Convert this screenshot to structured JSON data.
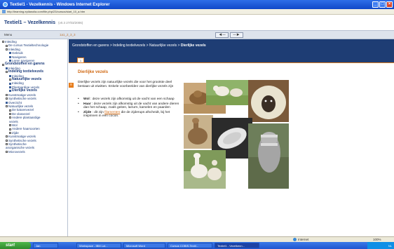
{
  "window": {
    "title": "Textiel1 - Vezelkennis - Windows Internet Explorer",
    "address": "http://learning.epilanolia.com/file.php/23/cursus/start_10_a.htm",
    "controls": [
      "_",
      "□",
      "×"
    ]
  },
  "app": {
    "title": "Textiel1 – Vezelkennis",
    "version": "(v0.3 27/03/2006)"
  },
  "menubar": {
    "label": "Menu",
    "code": "1a1_2_3_3",
    "prev_arrow": "◄─",
    "next_arrow": "─►"
  },
  "tree": [
    {
      "label": "Inleiding",
      "level": 1,
      "type": "folder"
    },
    {
      "label": "De cursus Textieltechnologie",
      "level": 2,
      "type": "folder"
    },
    {
      "label": "Inleiding",
      "level": 2,
      "type": "folder"
    },
    {
      "label": "Gebruik",
      "level": 3,
      "type": "page"
    },
    {
      "label": "Navigeren",
      "level": 3,
      "type": "page"
    },
    {
      "label": "Leren navigeren",
      "level": 3,
      "type": "page"
    },
    {
      "label": "Grondstoffen en garens",
      "level": 1,
      "type": "folder",
      "bold": true
    },
    {
      "label": "Inleiding",
      "level": 2,
      "type": "page"
    },
    {
      "label": "Indeling textielvezels",
      "level": 2,
      "type": "folder",
      "bold": true
    },
    {
      "label": "Inleiding",
      "level": 3,
      "type": "page"
    },
    {
      "label": "Natuurlijke vezels",
      "level": 3,
      "type": "folder",
      "bold": true
    },
    {
      "label": "Inleiding",
      "level": 3,
      "type": "page"
    },
    {
      "label": "Plantaardige vezels",
      "level": 3,
      "type": "page"
    },
    {
      "label": "Dierlijke vezels",
      "level": 3,
      "type": "page",
      "bold": true
    },
    {
      "label": "Kunstmatige vezels",
      "level": 2,
      "type": "folder"
    },
    {
      "label": "Synthetische vezels",
      "level": 2,
      "type": "folder"
    },
    {
      "label": "Overzicht",
      "level": 2,
      "type": "page"
    },
    {
      "label": "Natuurlijke vezels",
      "level": 2,
      "type": "folder"
    },
    {
      "label": "De katoenvezel",
      "level": 3,
      "type": "folder"
    },
    {
      "label": "De vlasvezel",
      "level": 3,
      "type": "folder"
    },
    {
      "label": "Andere plantaardige",
      "level": 3,
      "type": "folder"
    },
    {
      "label": "vezels",
      "level": 3,
      "type": "text"
    },
    {
      "label": "Wol",
      "level": 3,
      "type": "folder"
    },
    {
      "label": "Andere haarsoorten",
      "level": 3,
      "type": "folder"
    },
    {
      "label": "Zijde",
      "level": 3,
      "type": "folder"
    },
    {
      "label": "Kunstmatige vezels",
      "level": 2,
      "type": "folder"
    },
    {
      "label": "Synthetische vezels",
      "level": 2,
      "type": "folder"
    },
    {
      "label": "Synthetische",
      "level": 2,
      "type": "folder"
    },
    {
      "label": "anorganische vezels",
      "level": 2,
      "type": "text"
    },
    {
      "label": "Microvezels",
      "level": 2,
      "type": "folder"
    }
  ],
  "breadcrumb": {
    "path": "Grondstoffen en garens > Indeling textielvezels > Natuurlijke vezels > ",
    "current": "Dierlijke vezels"
  },
  "tab": {
    "label": "1"
  },
  "content": {
    "title": "Dierlijke vezels",
    "side_icon": "≡",
    "intro": "Dierlijke vezels zijn natuurlijke vezels die voor het grootste deel bestaan uit eiwitten. Enkele voorbeelden van dierlijke vezels zijn",
    "bullets": [
      {
        "term": "Wol",
        "text": " : deze vezels zijn afkomstig uit de vacht van een schaap"
      },
      {
        "term": "Haar",
        "text": " : deze vezels zijn afkomstig uit de vacht van andere dieren dan het schaap, zoals geiten, lama's, kamelen en paarden"
      },
      {
        "term": "Zijde",
        "text": " : dit zijn ",
        "link": "filamenten",
        "text_after": " die de zijderups afscheidt, bij het inspinnen in een cocon."
      }
    ],
    "bullet_mark": "•"
  },
  "statusbar": {
    "zone": "Internet",
    "zoom": "100%"
  },
  "taskbar": {
    "start": "start",
    "items": [
      "Jan",
      "Workspace - IBM Lot...",
      "Microsoft Word",
      "Cursus COBIS-Textil...",
      "Textiel1 - Vezelkenn..."
    ],
    "tray": "NL"
  },
  "colors": {
    "nav_blue": "#1e3d74",
    "accent_orange": "#d16a14",
    "title_blue": "#1b3b7a"
  }
}
